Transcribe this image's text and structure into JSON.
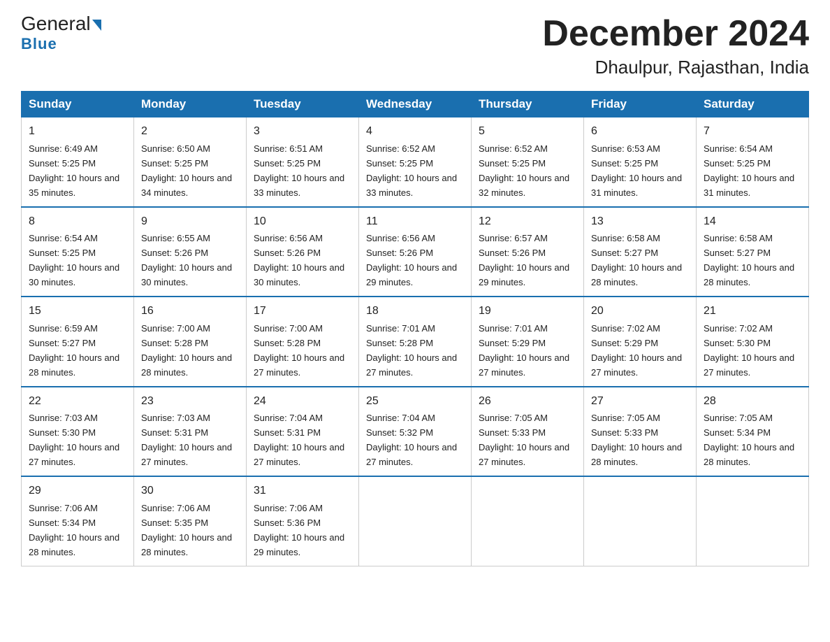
{
  "logo": {
    "general": "General",
    "blue": "Blue",
    "arrow": "▶"
  },
  "header": {
    "month": "December 2024",
    "location": "Dhaulpur, Rajasthan, India"
  },
  "weekdays": [
    "Sunday",
    "Monday",
    "Tuesday",
    "Wednesday",
    "Thursday",
    "Friday",
    "Saturday"
  ],
  "weeks": [
    [
      {
        "day": "1",
        "sunrise": "6:49 AM",
        "sunset": "5:25 PM",
        "daylight": "10 hours and 35 minutes"
      },
      {
        "day": "2",
        "sunrise": "6:50 AM",
        "sunset": "5:25 PM",
        "daylight": "10 hours and 34 minutes"
      },
      {
        "day": "3",
        "sunrise": "6:51 AM",
        "sunset": "5:25 PM",
        "daylight": "10 hours and 33 minutes"
      },
      {
        "day": "4",
        "sunrise": "6:52 AM",
        "sunset": "5:25 PM",
        "daylight": "10 hours and 33 minutes"
      },
      {
        "day": "5",
        "sunrise": "6:52 AM",
        "sunset": "5:25 PM",
        "daylight": "10 hours and 32 minutes"
      },
      {
        "day": "6",
        "sunrise": "6:53 AM",
        "sunset": "5:25 PM",
        "daylight": "10 hours and 31 minutes"
      },
      {
        "day": "7",
        "sunrise": "6:54 AM",
        "sunset": "5:25 PM",
        "daylight": "10 hours and 31 minutes"
      }
    ],
    [
      {
        "day": "8",
        "sunrise": "6:54 AM",
        "sunset": "5:25 PM",
        "daylight": "10 hours and 30 minutes"
      },
      {
        "day": "9",
        "sunrise": "6:55 AM",
        "sunset": "5:26 PM",
        "daylight": "10 hours and 30 minutes"
      },
      {
        "day": "10",
        "sunrise": "6:56 AM",
        "sunset": "5:26 PM",
        "daylight": "10 hours and 30 minutes"
      },
      {
        "day": "11",
        "sunrise": "6:56 AM",
        "sunset": "5:26 PM",
        "daylight": "10 hours and 29 minutes"
      },
      {
        "day": "12",
        "sunrise": "6:57 AM",
        "sunset": "5:26 PM",
        "daylight": "10 hours and 29 minutes"
      },
      {
        "day": "13",
        "sunrise": "6:58 AM",
        "sunset": "5:27 PM",
        "daylight": "10 hours and 28 minutes"
      },
      {
        "day": "14",
        "sunrise": "6:58 AM",
        "sunset": "5:27 PM",
        "daylight": "10 hours and 28 minutes"
      }
    ],
    [
      {
        "day": "15",
        "sunrise": "6:59 AM",
        "sunset": "5:27 PM",
        "daylight": "10 hours and 28 minutes"
      },
      {
        "day": "16",
        "sunrise": "7:00 AM",
        "sunset": "5:28 PM",
        "daylight": "10 hours and 28 minutes"
      },
      {
        "day": "17",
        "sunrise": "7:00 AM",
        "sunset": "5:28 PM",
        "daylight": "10 hours and 27 minutes"
      },
      {
        "day": "18",
        "sunrise": "7:01 AM",
        "sunset": "5:28 PM",
        "daylight": "10 hours and 27 minutes"
      },
      {
        "day": "19",
        "sunrise": "7:01 AM",
        "sunset": "5:29 PM",
        "daylight": "10 hours and 27 minutes"
      },
      {
        "day": "20",
        "sunrise": "7:02 AM",
        "sunset": "5:29 PM",
        "daylight": "10 hours and 27 minutes"
      },
      {
        "day": "21",
        "sunrise": "7:02 AM",
        "sunset": "5:30 PM",
        "daylight": "10 hours and 27 minutes"
      }
    ],
    [
      {
        "day": "22",
        "sunrise": "7:03 AM",
        "sunset": "5:30 PM",
        "daylight": "10 hours and 27 minutes"
      },
      {
        "day": "23",
        "sunrise": "7:03 AM",
        "sunset": "5:31 PM",
        "daylight": "10 hours and 27 minutes"
      },
      {
        "day": "24",
        "sunrise": "7:04 AM",
        "sunset": "5:31 PM",
        "daylight": "10 hours and 27 minutes"
      },
      {
        "day": "25",
        "sunrise": "7:04 AM",
        "sunset": "5:32 PM",
        "daylight": "10 hours and 27 minutes"
      },
      {
        "day": "26",
        "sunrise": "7:05 AM",
        "sunset": "5:33 PM",
        "daylight": "10 hours and 27 minutes"
      },
      {
        "day": "27",
        "sunrise": "7:05 AM",
        "sunset": "5:33 PM",
        "daylight": "10 hours and 28 minutes"
      },
      {
        "day": "28",
        "sunrise": "7:05 AM",
        "sunset": "5:34 PM",
        "daylight": "10 hours and 28 minutes"
      }
    ],
    [
      {
        "day": "29",
        "sunrise": "7:06 AM",
        "sunset": "5:34 PM",
        "daylight": "10 hours and 28 minutes"
      },
      {
        "day": "30",
        "sunrise": "7:06 AM",
        "sunset": "5:35 PM",
        "daylight": "10 hours and 28 minutes"
      },
      {
        "day": "31",
        "sunrise": "7:06 AM",
        "sunset": "5:36 PM",
        "daylight": "10 hours and 29 minutes"
      },
      null,
      null,
      null,
      null
    ]
  ]
}
